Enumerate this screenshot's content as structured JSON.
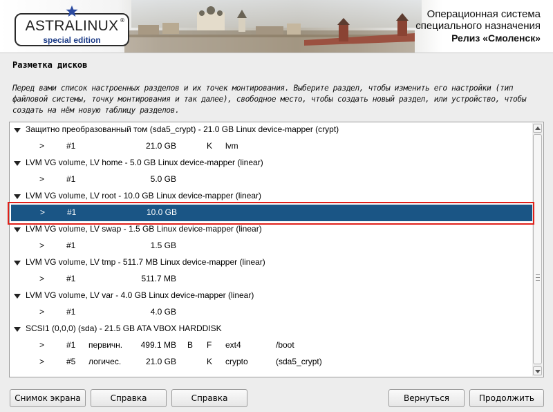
{
  "banner": {
    "logo_text": "ASTRALINUX",
    "logo_registered": "®",
    "logo_subtitle": "special edition",
    "os_title_line1": "Операционная система",
    "os_title_line2": "специального назначения",
    "release": "Релиз «Смоленск»"
  },
  "page": {
    "title": "Разметка дисков",
    "description": "Перед вами список настроенных разделов и их точек монтирования. Выберите раздел, чтобы изменить его настройки (тип файловой системы, точку монтирования и так далее), свободное место, чтобы создать новый раздел, или устройство, чтобы создать на нём новую таблицу разделов."
  },
  "partitions": [
    {
      "kind": "device",
      "text": "Защитно преобразованный том (sda5_crypt) - 21.0 GB Linux device-mapper (crypt)"
    },
    {
      "kind": "part",
      "arrow": ">",
      "num": "#1",
      "type": "",
      "size": "21.0 GB",
      "flag1": "",
      "flag2": "K",
      "fs": "lvm",
      "mount": ""
    },
    {
      "kind": "device",
      "text": "LVM VG volume, LV home - 5.0 GB Linux device-mapper (linear)"
    },
    {
      "kind": "part",
      "arrow": ">",
      "num": "#1",
      "type": "",
      "size": "5.0 GB",
      "flag1": "",
      "flag2": "",
      "fs": "",
      "mount": ""
    },
    {
      "kind": "device",
      "text": "LVM VG volume, LV root - 10.0 GB Linux device-mapper (linear)"
    },
    {
      "kind": "part",
      "arrow": ">",
      "num": "#1",
      "type": "",
      "size": "10.0 GB",
      "flag1": "",
      "flag2": "",
      "fs": "",
      "mount": "",
      "selected": true
    },
    {
      "kind": "device",
      "text": "LVM VG volume, LV swap - 1.5 GB Linux device-mapper (linear)"
    },
    {
      "kind": "part",
      "arrow": ">",
      "num": "#1",
      "type": "",
      "size": "1.5 GB",
      "flag1": "",
      "flag2": "",
      "fs": "",
      "mount": ""
    },
    {
      "kind": "device",
      "text": "LVM VG volume, LV tmp - 511.7 MB Linux device-mapper (linear)"
    },
    {
      "kind": "part",
      "arrow": ">",
      "num": "#1",
      "type": "",
      "size": "511.7 MB",
      "flag1": "",
      "flag2": "",
      "fs": "",
      "mount": ""
    },
    {
      "kind": "device",
      "text": "LVM VG volume, LV var - 4.0 GB Linux device-mapper (linear)"
    },
    {
      "kind": "part",
      "arrow": ">",
      "num": "#1",
      "type": "",
      "size": "4.0 GB",
      "flag1": "",
      "flag2": "",
      "fs": "",
      "mount": ""
    },
    {
      "kind": "device",
      "text": "SCSI1 (0,0,0) (sda) - 21.5 GB ATA VBOX HARDDISK"
    },
    {
      "kind": "part",
      "arrow": ">",
      "num": "#1",
      "type": "первичн.",
      "size": "499.1 MB",
      "flag1": "B",
      "flag2": "F",
      "fs": "ext4",
      "mount": "/boot"
    },
    {
      "kind": "part",
      "arrow": ">",
      "num": "#5",
      "type": "логичес.",
      "size": "21.0 GB",
      "flag1": "",
      "flag2": "K",
      "fs": "crypto",
      "mount": "(sda5_crypt)"
    }
  ],
  "buttons": {
    "screenshot": "Снимок экрана",
    "help1": "Справка",
    "help2": "Справка",
    "back": "Вернуться",
    "continue": "Продолжить"
  },
  "colors": {
    "selection": "#1a5585",
    "highlight_outline": "#e0201a"
  }
}
